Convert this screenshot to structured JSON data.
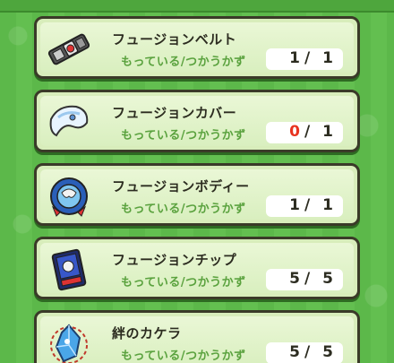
{
  "items": [
    {
      "name": "フュージョンベルト",
      "owned_label": "もっている/つかうかず",
      "have": "1",
      "slash": "/",
      "need": "1",
      "icon": "fusion-belt-icon",
      "short": false
    },
    {
      "name": "フュージョンカバー",
      "owned_label": "もっている/つかうかず",
      "have": "0",
      "slash": "/",
      "need": "1",
      "icon": "fusion-cover-icon",
      "short": true
    },
    {
      "name": "フュージョンボディー",
      "owned_label": "もっている/つかうかず",
      "have": "1",
      "slash": "/",
      "need": "1",
      "icon": "fusion-body-icon",
      "short": false
    },
    {
      "name": "フュージョンチップ",
      "owned_label": "もっている/つかうかず",
      "have": "5",
      "slash": "/",
      "need": "5",
      "icon": "fusion-chip-icon",
      "short": false
    },
    {
      "name": "絆のカケラ",
      "owned_label": "もっている/つかうかず",
      "have": "5",
      "slash": "/",
      "need": "5",
      "icon": "bond-fragment-icon",
      "short": false
    }
  ],
  "colors": {
    "shortage": "#e8331f",
    "owned_label": "#5aa23e",
    "card_border": "#3a3a28"
  }
}
